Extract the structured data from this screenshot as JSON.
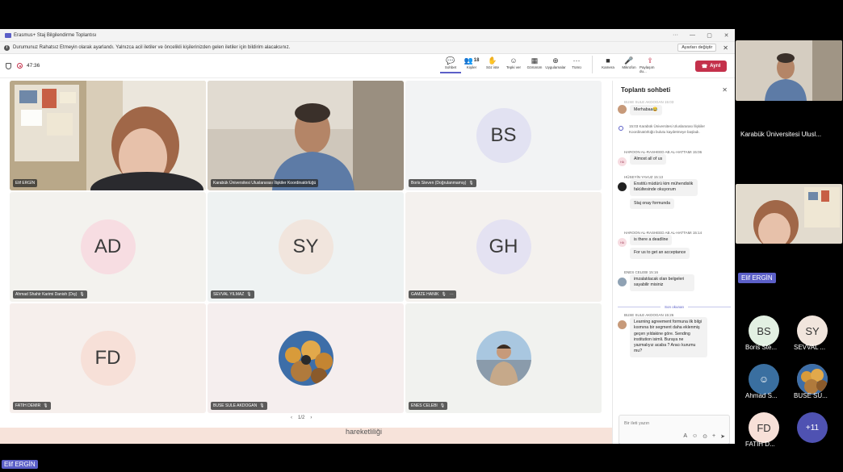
{
  "window": {
    "title": "Erasmus+ Staj Bilgilendirme Toplantısı",
    "controls": [
      "···",
      "—",
      "▢",
      "✕"
    ]
  },
  "notification": {
    "text": "Durumunuz Rahatsız Etmeyin olarak ayarlandı. Yalnızca acil iletiler ve öncelikli kişilerinizden gelen iletiler için bildirim alacaksınız.",
    "settings_button": "Ayarları değiştir",
    "close": "✕"
  },
  "meeting": {
    "timer": "47:36"
  },
  "toolbar": {
    "buttons": [
      {
        "label": "Sohbet",
        "icon": "💬"
      },
      {
        "label": "Kişiler",
        "icon": "👥",
        "count": "18"
      },
      {
        "label": "Söz iste",
        "icon": "✋"
      },
      {
        "label": "Tepki ver",
        "icon": "☺"
      },
      {
        "label": "Görünüm",
        "icon": "▦"
      },
      {
        "label": "Uygulamalar",
        "icon": "⊕"
      },
      {
        "label": "Tümü",
        "icon": "···"
      },
      {
        "label": "Kamera",
        "icon": "■"
      },
      {
        "label": "Mikrofon",
        "icon": "🎤"
      },
      {
        "label": "Paylaşım du...",
        "icon": "⇪"
      }
    ],
    "leave_label": "Ayrıl",
    "leave_icon": "☎"
  },
  "tiles": [
    {
      "name": "Elif ERGİN",
      "type": "video"
    },
    {
      "name": "Karabük Üniversitesi Uluslararası İlişkiler Koordinatörlüğü",
      "type": "video"
    },
    {
      "name": "Boris Steven (Doğrulanmamış)",
      "initials": "BS",
      "type": "initials",
      "color": "#e2e2f2",
      "mic": true
    },
    {
      "name": "Ahmad Shahir Karimi Danish (Dış)",
      "initials": "AD",
      "type": "initials",
      "color": "#f7dde2",
      "mic": true
    },
    {
      "name": "SEVVAL YILMAZ",
      "initials": "SY",
      "type": "initials",
      "color": "#f1e5dd",
      "mic": true
    },
    {
      "name": "GAMZE HANIK",
      "initials": "GH",
      "type": "initials",
      "color": "#e4e2f2",
      "mic": true,
      "more": "···"
    },
    {
      "name": "FATIH DEMIR",
      "initials": "FD",
      "type": "initials",
      "color": "#f7e0d8",
      "mic": true
    },
    {
      "name": "BUSE SULE AKDOGAN",
      "type": "photo",
      "mic": true
    },
    {
      "name": "ENES CELEBI",
      "type": "photo2",
      "mic": true
    }
  ],
  "pager": {
    "prev": "‹",
    "text": "1/2",
    "next": "›"
  },
  "bottom_text": "hareketliliği",
  "chat": {
    "title": "Toplantı sohbeti",
    "close": "✕",
    "messages": [
      {
        "sender": "BUSE SULE AKDOGAN 15:03",
        "text": "Merhabaa😂"
      },
      {
        "system": true,
        "time": "15:03",
        "text": "Karabük Üniversitesi Uluslararası İlişkiler Koordinatörlüğü bulutu kaydetmeye başladı."
      },
      {
        "sender": "HAROON AL-RASHEED AB AL-HATTAMI 15:06",
        "text": "Almost all of us",
        "avatar": "HA"
      },
      {
        "sender": "HÜSEYİN YAVUZ 15:13",
        "text": "Enstitü müdürü kim mühendislik fakültesinde okuyorum",
        "text2": "Staj onay formunda"
      },
      {
        "sender": "HAROON AL-RASHEED AB AL-HATTAMI 15:14",
        "text": "is there a deadline",
        "text2": "For us to get an acceptance",
        "avatar": "HA"
      },
      {
        "sender": "ENES CELEBI 15:16",
        "text": "imzalatılacak olan belgeleri sayabilir misiniz"
      },
      {
        "sender": "BUSE SULE AKDOGAN 15:26",
        "text": "Learning agreement formuna ilk bilgi kısmına bir segment daha eklenmiş geçen yıldakine göre. Sending institution isimli. Buraya ne yazmalıyız acaba ? Aracı kurumu mu?"
      }
    ],
    "last_read": "Son okunan",
    "compose_placeholder": "Bir ileti yazın",
    "compose_icons": [
      "A",
      "☺",
      "⊙",
      "+",
      "➤"
    ]
  },
  "side": {
    "top_name": "Karabük Üniversitesi Ulusl...",
    "self_name": "Elif ERGİN",
    "participants": [
      {
        "initials": "BS",
        "label": "Boris Ste...",
        "color": "#e2f0e2"
      },
      {
        "initials": "SY",
        "label": "SEVVAL ...",
        "color": "#f1e5dd"
      },
      {
        "initials": "",
        "label": "Ahmad S...",
        "color": "#3a6fa0"
      },
      {
        "initials": "",
        "label": "BUSE SU...",
        "color": "#c09050"
      },
      {
        "initials": "FD",
        "label": "FATIH D...",
        "color": "#f7e0d8"
      },
      {
        "initials": "+11",
        "label": "",
        "color": "#4f52b2"
      }
    ]
  },
  "bottom_label": "Elif ERGİN"
}
